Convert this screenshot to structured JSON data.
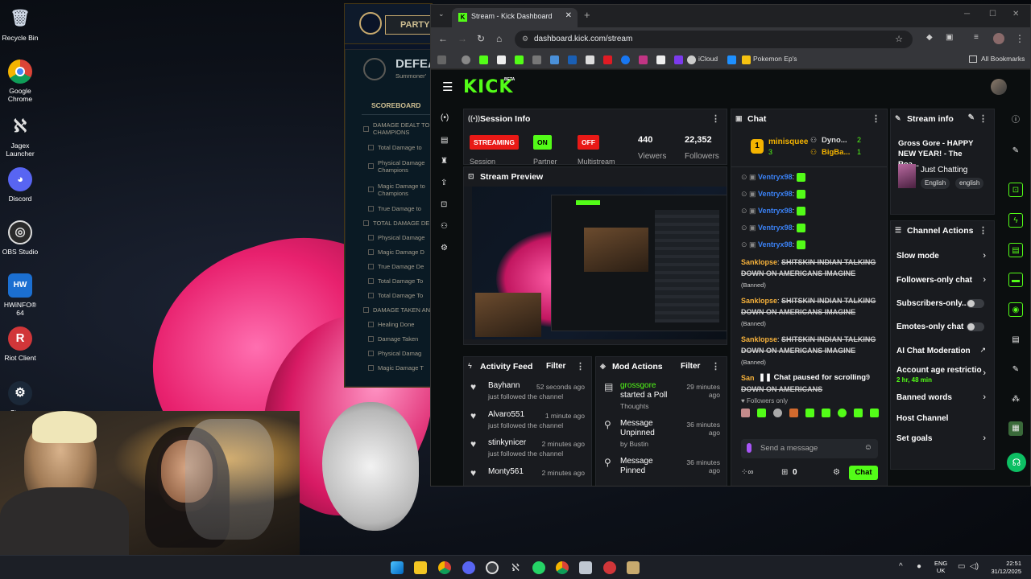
{
  "desktop": {
    "icons": [
      {
        "label": "Recycle Bin",
        "icon": "recycle-bin-icon"
      },
      {
        "label": "Google Chrome",
        "icon": "chrome-icon"
      },
      {
        "label": "Jagex Launcher",
        "icon": "jagex-icon"
      },
      {
        "label": "Discord",
        "icon": "discord-icon"
      },
      {
        "label": "OBS Studio",
        "icon": "obs-icon"
      },
      {
        "label": "HWiNFO® 64",
        "icon": "hwinfo-icon"
      },
      {
        "label": "Riot Client",
        "icon": "riot-icon"
      },
      {
        "label": "Steam",
        "icon": "steam-icon"
      }
    ]
  },
  "league": {
    "party_label": "PARTY",
    "result": "DEFEA",
    "summoner": "Summoner'",
    "scoreboard": "SCOREBOARD",
    "rows": [
      "DAMAGE DEALT TO CHAMPIONS",
      "Total Damage to",
      "Physical Damage Champions",
      "Magic Damage to Champions",
      "True Damage to",
      "TOTAL DAMAGE DE",
      "Physical Damage",
      "Magic Damage D",
      "True Damage De",
      "Total Damage To",
      "Total Damage To",
      "DAMAGE TAKEN AN",
      "Healing Done",
      "Damage Taken",
      "Physical Damag",
      "Magic Damage T"
    ]
  },
  "browser": {
    "tab_title": "Stream - Kick Dashboard",
    "url": "dashboard.kick.com/stream",
    "bookmarks": [
      "iCloud",
      "Pokemon Ep's"
    ],
    "all_bookmarks": "All Bookmarks"
  },
  "kick": {
    "logo": "KICK",
    "beta": "BETA",
    "session": {
      "title": "Session Info",
      "streaming": "STREAMING",
      "on": "ON",
      "off": "OFF",
      "viewers": "440",
      "viewers_label": "Viewers",
      "followers": "22,352",
      "followers_label": "Followers",
      "session_label": "Session",
      "partner_label": "Partner",
      "multistream_label": "Multistream"
    },
    "preview": {
      "title": "Stream Preview"
    },
    "activity": {
      "title": "Activity Feed",
      "filter": "Filter",
      "items": [
        {
          "name": "Bayhann",
          "sub": "just followed the channel",
          "time": "52 seconds ago"
        },
        {
          "name": "Alvaro551",
          "sub": "just followed the channel",
          "time": "1 minute ago"
        },
        {
          "name": "stinkynicer",
          "sub": "just followed the channel",
          "time": "2 minutes ago"
        },
        {
          "name": "Monty561",
          "sub": "",
          "time": "2 minutes ago"
        }
      ]
    },
    "mod": {
      "title": "Mod Actions",
      "filter": "Filter",
      "items": [
        {
          "name": "grossgore",
          "line2": "started a Poll",
          "line3": "Thoughts",
          "time": "29 minutes ago"
        },
        {
          "name": "Message Unpinned",
          "line2": "by Bustin",
          "line3": "",
          "time": "36 minutes ago"
        },
        {
          "name": "Message Pinned",
          "line2": "",
          "line3": "",
          "time": "36 minutes ago"
        }
      ]
    },
    "chat": {
      "title": "Chat",
      "top": [
        {
          "name": "minisquee",
          "count": "3"
        },
        {
          "name": "Dyno...",
          "count": "2"
        },
        {
          "name": "BigBa...",
          "count": "1"
        }
      ],
      "ventryx": [
        "Ventryx98",
        "Ventryx98",
        "Ventryx98",
        "Ventryx98",
        "Ventryx98"
      ],
      "banned": [
        {
          "user": "Sanklopse",
          "text": "SHITSKIN INDIAN TALKING DOWN ON AMERICANS IMAGINE",
          "tag": "(Banned)"
        },
        {
          "user": "Sanklopse",
          "text": "SHITSKIN INDIAN TALKING DOWN ON AMERICANS IMAGINE",
          "tag": "(Banned)"
        },
        {
          "user": "Sanklopse",
          "text": "SHITSKIN INDIAN TALKING DOWN ON AMERICANS IMAGINE",
          "tag": "(Banned)"
        }
      ],
      "partial_user": "San",
      "partial_text": "DOWN ON AMERICANS",
      "paused": "Chat paused for scrolling",
      "paused_count": "9",
      "followers_only": "Followers only",
      "placeholder": "Send a message",
      "points": "0",
      "send": "Chat"
    },
    "stream_info": {
      "title": "Stream info",
      "stream_title": "Gross Gore - HAPPY NEW YEAR! - The Roa...",
      "category": "Just Chatting",
      "tags": [
        "English",
        "english"
      ]
    },
    "channel_actions": {
      "title": "Channel Actions",
      "items": [
        {
          "label": "Slow mode",
          "kind": "chevron"
        },
        {
          "label": "Followers-only chat",
          "kind": "chevron"
        },
        {
          "label": "Subscribers-only...",
          "kind": "toggle"
        },
        {
          "label": "Emotes-only chat",
          "kind": "toggle"
        },
        {
          "label": "AI Chat Moderation",
          "kind": "external"
        },
        {
          "label": "Account age restrictio",
          "kind": "chevron",
          "sub": "2 hr, 48 min"
        },
        {
          "label": "Banned words",
          "kind": "chevron"
        },
        {
          "label": "Host Channel",
          "kind": "none"
        },
        {
          "label": "Set goals",
          "kind": "chevron"
        }
      ]
    }
  },
  "taskbar": {
    "lang1": "ENG",
    "lang2": "UK",
    "time": "22:51",
    "date": "31/12/2025"
  },
  "colors": {
    "kick_green": "#53fc18",
    "streaming_red": "#e91916",
    "banned_user": "#f7b23b",
    "chatter_blue": "#3b82f6"
  }
}
